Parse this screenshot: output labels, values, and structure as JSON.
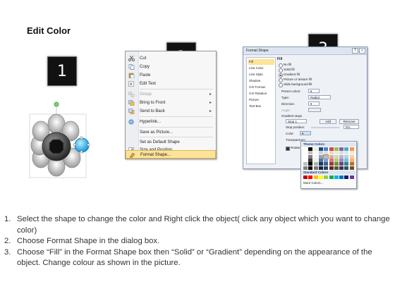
{
  "title": "Edit Color",
  "badges": [
    "1",
    "2",
    "3"
  ],
  "context_menu": {
    "items": [
      {
        "label": "Cut",
        "icon": "scissors-icon"
      },
      {
        "label": "Copy",
        "icon": "copy-icon"
      },
      {
        "label": "Paste",
        "icon": "paste-icon"
      },
      {
        "label": "Edit Text",
        "icon": "edit-text-icon"
      },
      {
        "label": "Group",
        "icon": "group-icon",
        "disabled": true,
        "submenu": true
      },
      {
        "label": "Bring to Front",
        "icon": "bring-front-icon",
        "submenu": true
      },
      {
        "label": "Send to Back",
        "icon": "send-back-icon",
        "submenu": true
      },
      {
        "label": "Hyperlink...",
        "icon": "hyperlink-icon"
      },
      {
        "label": "Save as Picture...",
        "icon": ""
      },
      {
        "label": "Set as Default Shape",
        "icon": ""
      },
      {
        "label": "Size and Position...",
        "icon": "size-icon"
      },
      {
        "label": "Format Shape...",
        "icon": "format-shape-icon",
        "highlighted": true
      }
    ]
  },
  "dialog": {
    "title": "Format Shape",
    "nav": [
      "Fill",
      "Line Color",
      "Line Style",
      "Shadow",
      "3-D Format",
      "3-D Rotation",
      "Picture",
      "Text Box"
    ],
    "selected_nav": "Fill",
    "heading": "Fill",
    "options": [
      "No fill",
      "Solid fill",
      "Gradient fill",
      "Picture or texture fill",
      "Slide background fill"
    ],
    "selected_option": "Gradient fill",
    "labels": {
      "preset": "Preset colors:",
      "type": "Type:",
      "type_value": "Radial",
      "direction": "Direction:",
      "angle": "Angle:",
      "gradient_stops": "Gradient stops",
      "stop": "Stop 1",
      "add": "Add",
      "remove": "Remove",
      "stop_position": "Stop position:",
      "stop_position_value": "0%",
      "color": "Color:",
      "transparency": "Transparency:",
      "rotate": "Rotate"
    },
    "palette": {
      "theme_label": "Theme Colors",
      "standard_label": "Standard Colors",
      "more_label": "More Colors...",
      "theme_top": [
        "#ffffff",
        "#000000",
        "#eeece1",
        "#1f497d",
        "#4f81bd",
        "#c0504d",
        "#9bbb59",
        "#8064a2",
        "#4bacc6",
        "#f79646"
      ],
      "standard": [
        "#c00000",
        "#ff0000",
        "#ffc000",
        "#ffff00",
        "#92d050",
        "#00b050",
        "#00b0f0",
        "#0070c0",
        "#002060",
        "#7030a0"
      ]
    }
  },
  "instructions": [
    {
      "num": "1.",
      "text": "Select the shape to change the color and Right click the object( click any object which you want to change color)"
    },
    {
      "num": "2.",
      "text": "Choose Format Shape in the dialog box."
    },
    {
      "num": "3.",
      "text": "Choose “Fill” in the Format Shape box then “Solid” or “Gradient” depending on the appearance of the object. Change colour as shown in the picture."
    }
  ]
}
